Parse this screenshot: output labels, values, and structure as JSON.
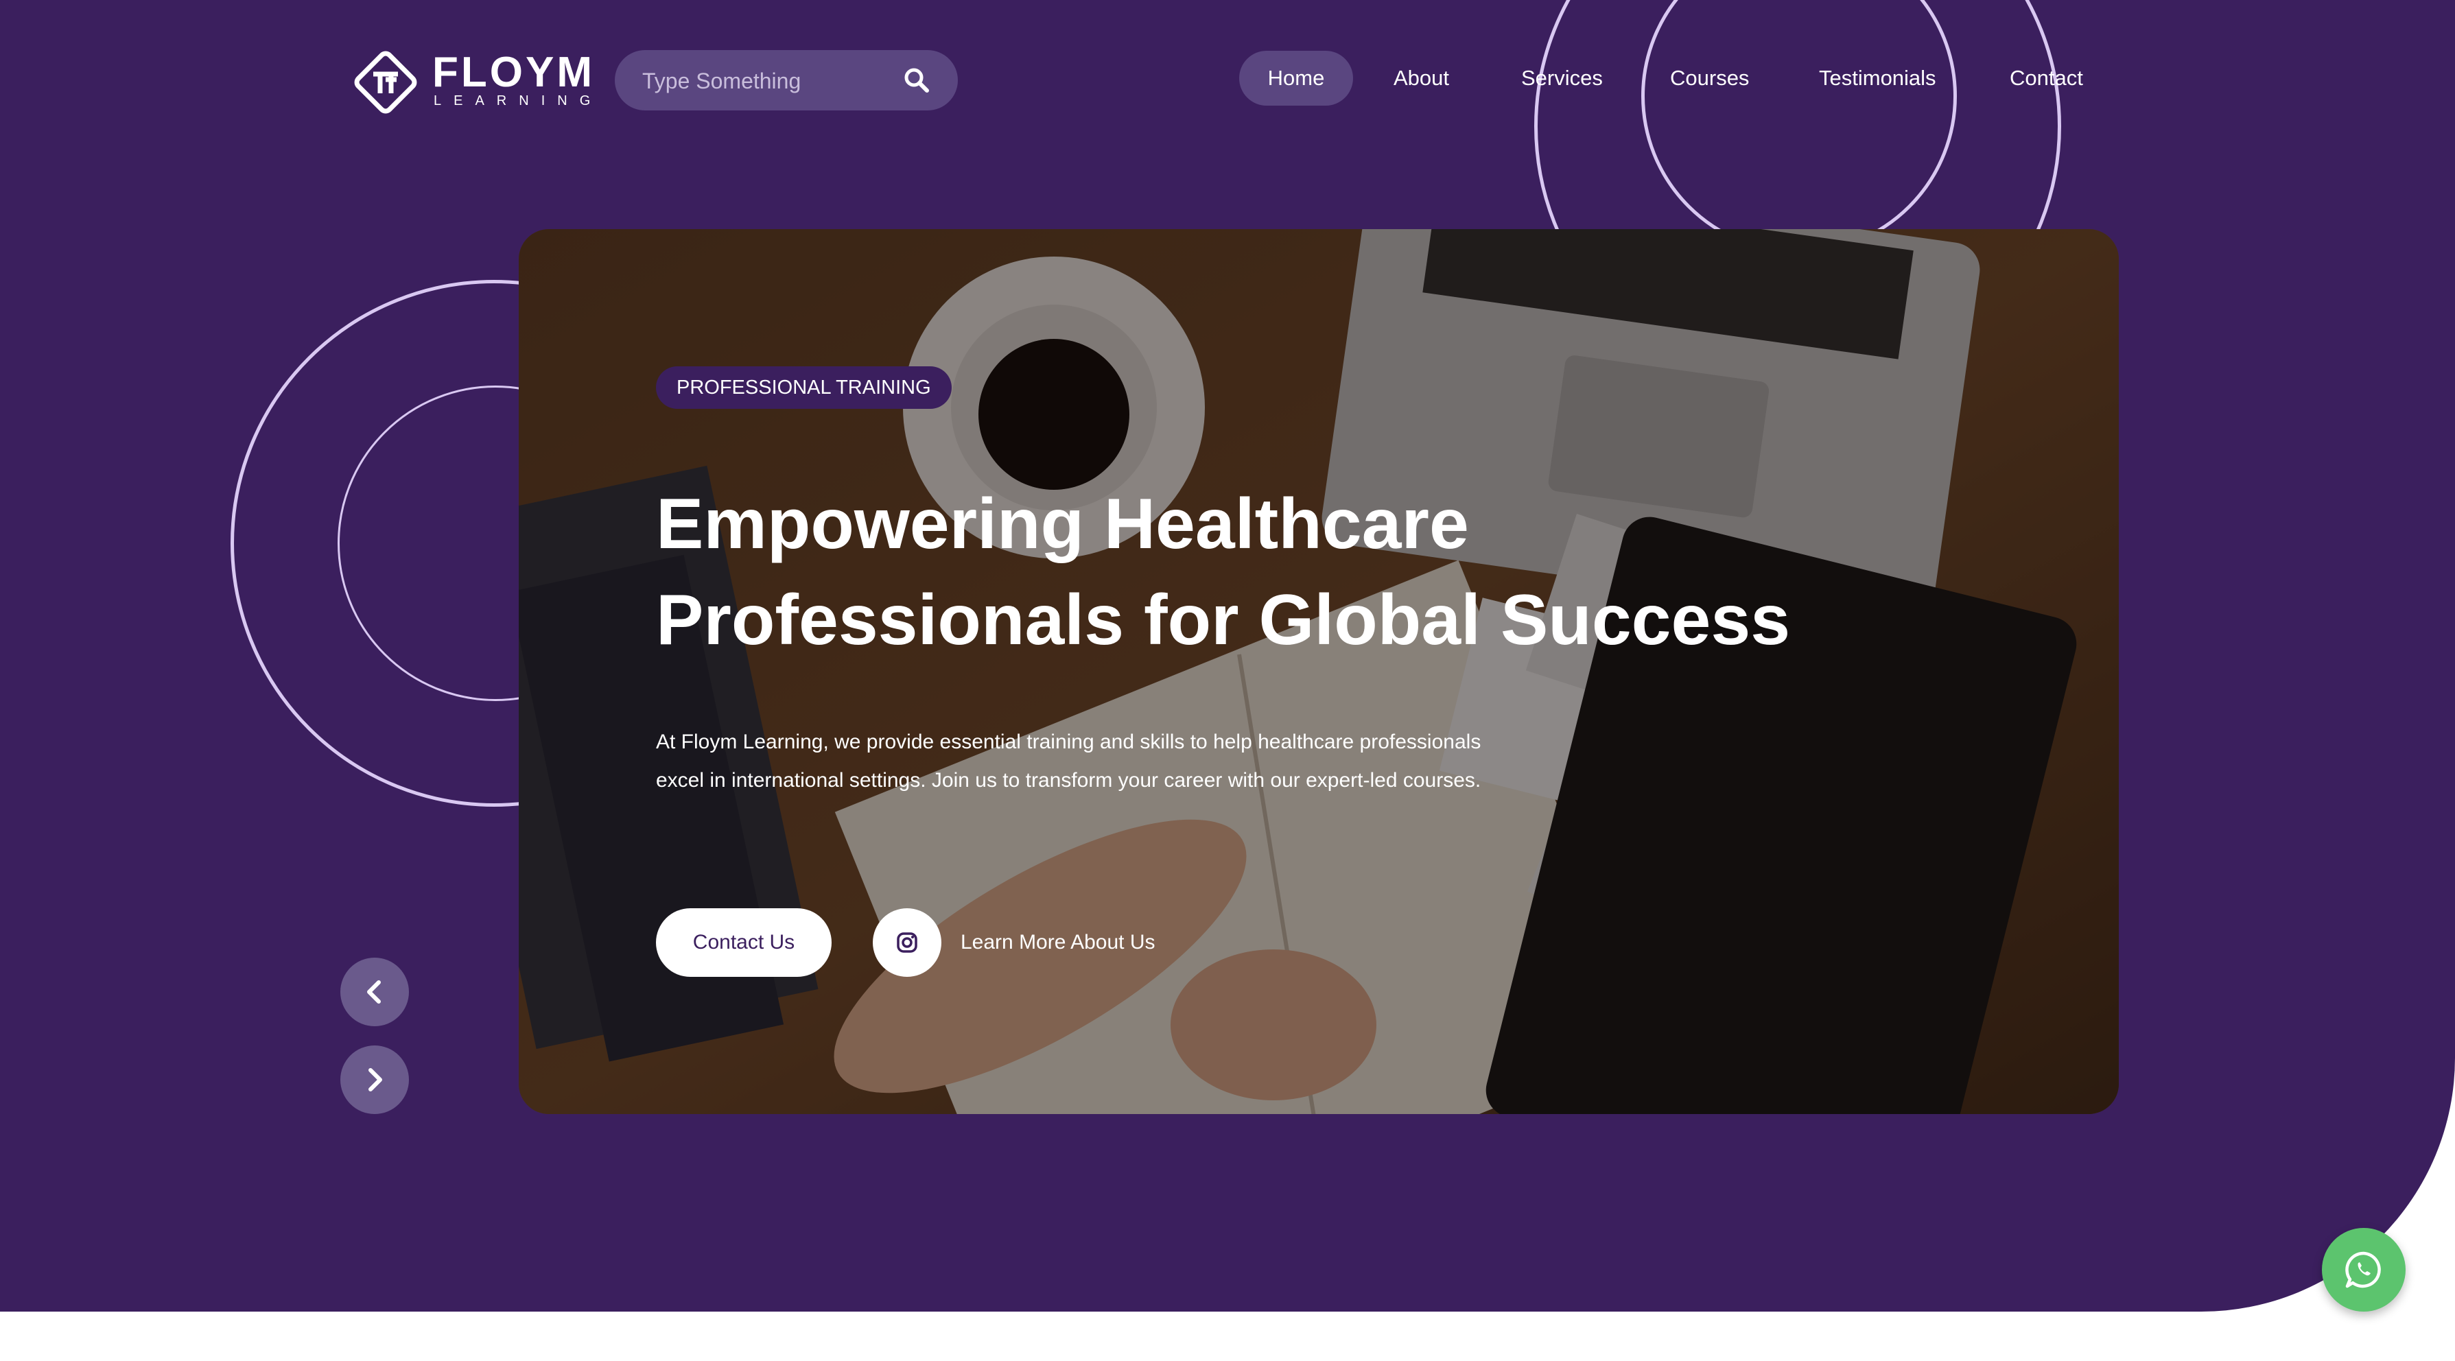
{
  "brand": {
    "name": "FLOYM",
    "sub": "LEARNING"
  },
  "search": {
    "placeholder": "Type Something",
    "icon": "search-icon"
  },
  "nav": {
    "items": [
      {
        "label": "Home",
        "active": true
      },
      {
        "label": "About"
      },
      {
        "label": "Services"
      },
      {
        "label": "Courses"
      },
      {
        "label": "Testimonials"
      },
      {
        "label": "Contact"
      }
    ]
  },
  "hero": {
    "badge": "PROFESSIONAL TRAINING",
    "title_line1": "Empowering Healthcare",
    "title_line2": "Professionals for Global Success",
    "description": "At Floym Learning, we provide essential training and skills to help healthcare professionals excel in international settings. Join us to transform your career with our expert-led courses.",
    "contact_button": "Contact Us",
    "learn_more": "Learn More About Us",
    "learn_icon": "instagram-icon"
  },
  "slider": {
    "prev_icon": "chevron-left-icon",
    "next_icon": "chevron-right-icon"
  },
  "whatsapp": {
    "icon": "whatsapp-icon"
  },
  "colors": {
    "primary": "#3b1f5e",
    "pill": "#5a4680",
    "ring": "#d9c8f2",
    "whatsapp": "#5cc46e"
  }
}
